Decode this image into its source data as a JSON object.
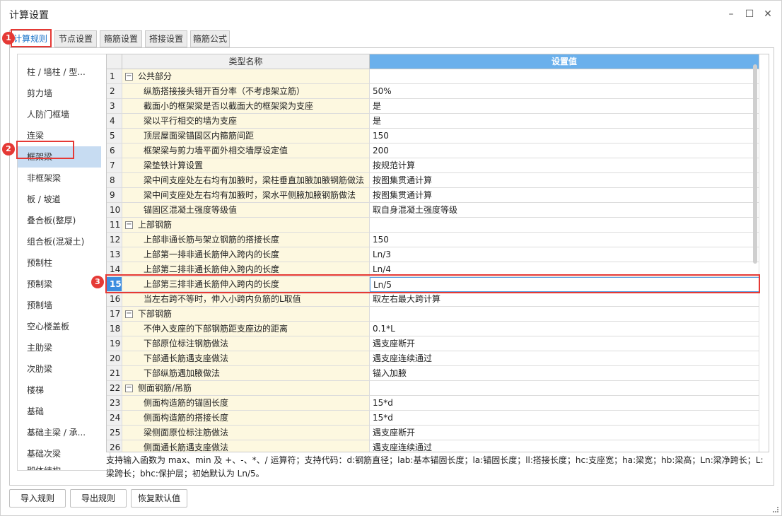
{
  "window": {
    "title": "计算设置",
    "minimize": "–",
    "maximize": "☐",
    "close": "✕"
  },
  "tabs": [
    {
      "label": "计算规则"
    },
    {
      "label": "节点设置"
    },
    {
      "label": "箍筋设置"
    },
    {
      "label": "搭接设置"
    },
    {
      "label": "箍筋公式"
    }
  ],
  "sidebar": {
    "items": [
      {
        "label": "柱 / 墙柱 / 型..."
      },
      {
        "label": "剪力墙"
      },
      {
        "label": "人防门框墙"
      },
      {
        "label": "连梁"
      },
      {
        "label": "框架梁"
      },
      {
        "label": "非框架梁"
      },
      {
        "label": "板 / 坡道"
      },
      {
        "label": "叠合板(整厚)"
      },
      {
        "label": "组合板(混凝土)"
      },
      {
        "label": "预制柱"
      },
      {
        "label": "预制梁"
      },
      {
        "label": "预制墙"
      },
      {
        "label": "空心楼盖板"
      },
      {
        "label": "主肋梁"
      },
      {
        "label": "次肋梁"
      },
      {
        "label": "楼梯"
      },
      {
        "label": "基础"
      },
      {
        "label": "基础主梁 / 承..."
      },
      {
        "label": "基础次梁"
      },
      {
        "label": "砌体结构"
      }
    ],
    "selected_index": 4
  },
  "grid": {
    "header_name": "类型名称",
    "header_value": "设置值",
    "rows": [
      {
        "num": "1",
        "name": "公共部分",
        "value": "",
        "group": true
      },
      {
        "num": "2",
        "name": "纵筋搭接接头错开百分率（不考虑架立筋）",
        "value": "50%"
      },
      {
        "num": "3",
        "name": "截面小的框架梁是否以截面大的框架梁为支座",
        "value": "是"
      },
      {
        "num": "4",
        "name": "梁以平行相交的墙为支座",
        "value": "是"
      },
      {
        "num": "5",
        "name": "顶层屋面梁锚固区内箍筋间距",
        "value": "150"
      },
      {
        "num": "6",
        "name": "框架梁与剪力墙平面外相交墙厚设定值",
        "value": "200"
      },
      {
        "num": "7",
        "name": "梁垫铁计算设置",
        "value": "按规范计算"
      },
      {
        "num": "8",
        "name": "梁中间支座处左右均有加腋时，梁柱垂直加腋加腋钢筋做法",
        "value": "按图集贯通计算"
      },
      {
        "num": "9",
        "name": "梁中间支座处左右均有加腋时，梁水平侧腋加腋钢筋做法",
        "value": "按图集贯通计算"
      },
      {
        "num": "10",
        "name": "锚固区混凝土强度等级值",
        "value": "取自身混凝土强度等级"
      },
      {
        "num": "11",
        "name": "上部钢筋",
        "value": "",
        "group": true
      },
      {
        "num": "12",
        "name": "上部非通长筋与架立钢筋的搭接长度",
        "value": "150"
      },
      {
        "num": "13",
        "name": "上部第一排非通长筋伸入跨内的长度",
        "value": "Ln/3"
      },
      {
        "num": "14",
        "name": "上部第二排非通长筋伸入跨内的长度",
        "value": "Ln/4"
      },
      {
        "num": "15",
        "name": "上部第三排非通长筋伸入跨内的长度",
        "value": "Ln/5",
        "selected": true
      },
      {
        "num": "16",
        "name": "当左右跨不等时，伸入小跨内负筋的L取值",
        "value": "取左右最大跨计算"
      },
      {
        "num": "17",
        "name": "下部钢筋",
        "value": "",
        "group": true
      },
      {
        "num": "18",
        "name": "不伸入支座的下部钢筋距支座边的距离",
        "value": "0.1*L"
      },
      {
        "num": "19",
        "name": "下部原位标注钢筋做法",
        "value": "遇支座断开"
      },
      {
        "num": "20",
        "name": "下部通长筋遇支座做法",
        "value": "遇支座连续通过"
      },
      {
        "num": "21",
        "name": "下部纵筋遇加腋做法",
        "value": "锚入加腋"
      },
      {
        "num": "22",
        "name": "侧面钢筋/吊筋",
        "value": "",
        "group": true
      },
      {
        "num": "23",
        "name": "侧面构造筋的锚固长度",
        "value": "15*d"
      },
      {
        "num": "24",
        "name": "侧面构造筋的搭接长度",
        "value": "15*d"
      },
      {
        "num": "25",
        "name": "梁侧面原位标注筋做法",
        "value": "遇支座断开"
      },
      {
        "num": "26",
        "name": "侧面通长筋遇支座做法",
        "value": "遇支座连续通过"
      }
    ]
  },
  "hint": "支持输入函数为 max、min 及 +、-、*、/ 运算符；支持代码：d:钢筋直径；lab:基本锚固长度；la:锚固长度；ll:搭接长度；hc:支座宽；ha:梁宽；hb:梁高；Ln:梁净跨长；L:梁跨长；bhc:保护层；初始默认为 Ln/5。",
  "buttons": {
    "import": "导入规则",
    "export": "导出规则",
    "reset": "恢复默认值"
  },
  "callouts": [
    "1",
    "2",
    "3"
  ],
  "colors": {
    "accent": "#1a73c9",
    "header_value_bg": "#6ab0ec",
    "name_bg": "#fdf8e0",
    "callout_red": "#e53935"
  }
}
